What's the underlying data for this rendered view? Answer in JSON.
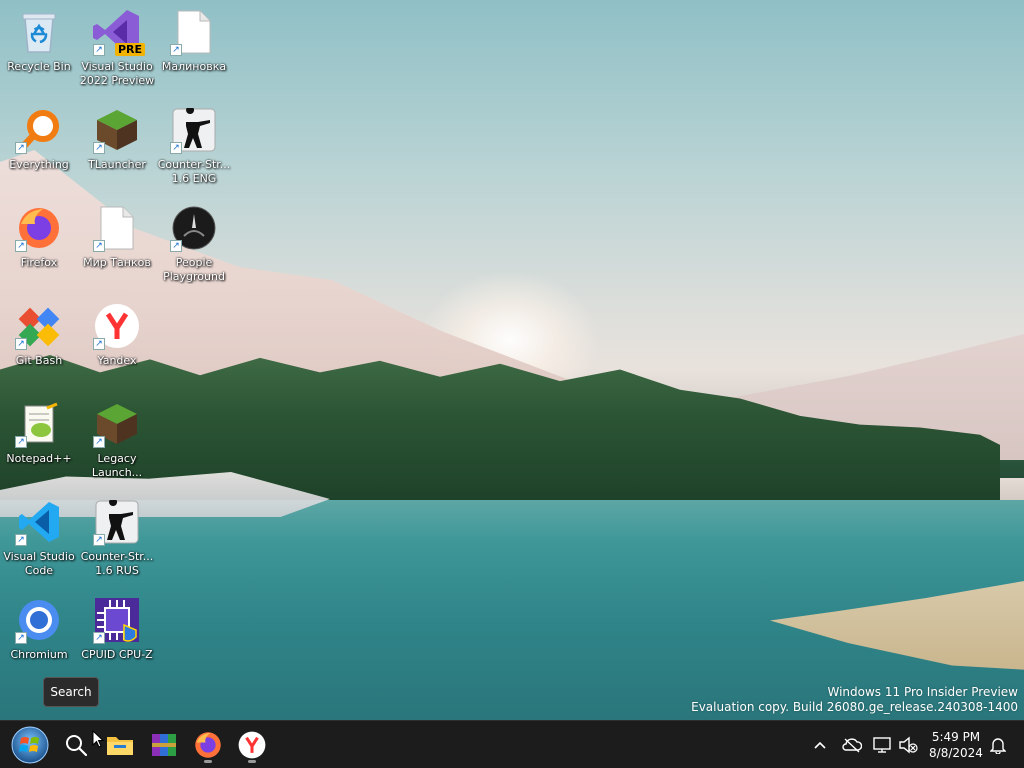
{
  "desktop": {
    "icons": [
      {
        "label": "Recycle Bin",
        "icon": "recycle-bin-icon"
      },
      {
        "label": "Visual Studio 2022 Preview",
        "icon": "visual-studio-icon",
        "badge": "PRE"
      },
      {
        "label": "Малиновка",
        "icon": "blank-document-icon"
      },
      {
        "label": "Everything",
        "icon": "everything-search-icon"
      },
      {
        "label": "TLauncher",
        "icon": "tlauncher-icon"
      },
      {
        "label": "Counter-Str... 1.6 ENG",
        "icon": "counter-strike-icon"
      },
      {
        "label": "Firefox",
        "icon": "firefox-icon"
      },
      {
        "label": "Мир Танков",
        "icon": "blank-document-icon"
      },
      {
        "label": "People Playground",
        "icon": "people-playground-icon"
      },
      {
        "label": "Git Bash",
        "icon": "git-bash-icon"
      },
      {
        "label": "Yandex",
        "icon": "yandex-browser-icon"
      },
      {
        "label": "Notepad++",
        "icon": "notepad-plus-plus-icon"
      },
      {
        "label": "Legacy Launch...",
        "icon": "legacy-launcher-icon"
      },
      {
        "label": "Visual Studio Code",
        "icon": "vscode-icon"
      },
      {
        "label": "Counter-Str... 1.6 RUS",
        "icon": "counter-strike-icon"
      },
      {
        "label": "Chromium",
        "icon": "chromium-icon"
      },
      {
        "label": "CPUID CPU-Z",
        "icon": "cpu-z-icon"
      }
    ]
  },
  "tooltip": {
    "text": "Search"
  },
  "watermark": {
    "line1": "Windows 11 Pro Insider Preview",
    "line2": "Evaluation copy. Build 26080.ge_release.240308-1400"
  },
  "taskbar": {
    "items": [
      "start-orb-icon",
      "search-icon",
      "file-explorer-icon",
      "winrar-icon",
      "firefox-icon",
      "yandex-browser-icon"
    ],
    "tray": {
      "chevron": "show-hidden-icons",
      "time": "5:49 PM",
      "date": "8/8/2024"
    }
  },
  "colors": {
    "taskbar_bg": "#1c1c1c",
    "label_text": "#ffffff"
  }
}
